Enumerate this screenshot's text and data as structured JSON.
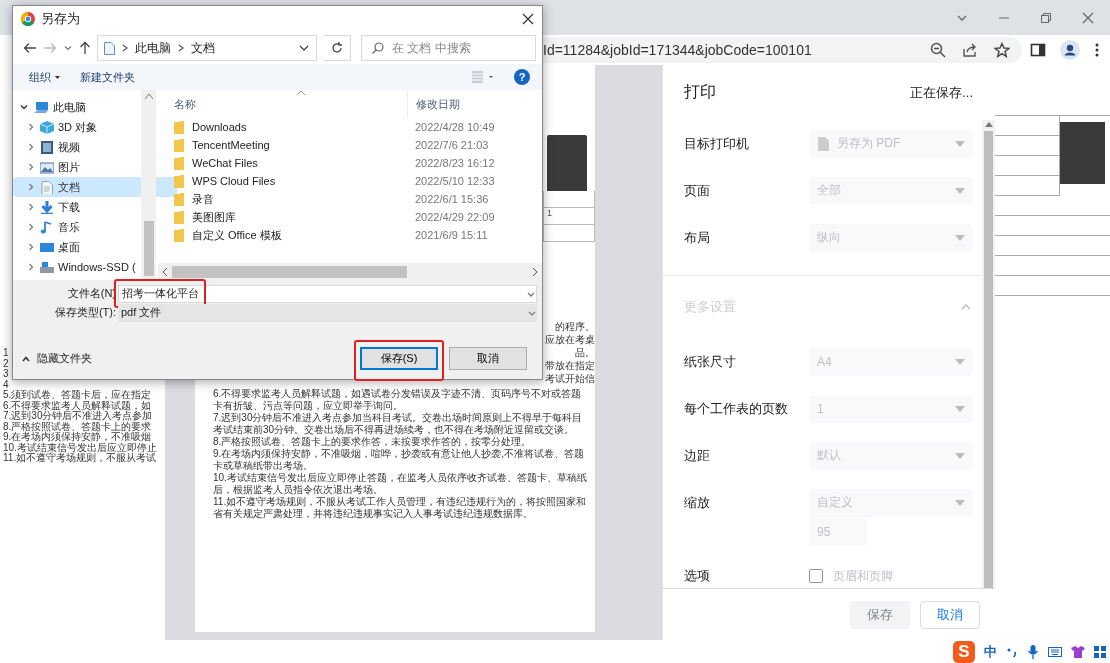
{
  "browser": {
    "url": "Id=11284&jobId=171344&jobCode=100101"
  },
  "left_page": {
    "numbers": [
      "1",
      "2",
      "3",
      "4"
    ],
    "lines": [
      "5.须到试卷、答题卡后，应在指定",
      "6.不得要求监考人员解释试题，如",
      "7.迟到30分钟后不准进入考点参加",
      "8.严格按照试卷、答题卡上的要求",
      "9.在考场内须保持安静，不准吸烟",
      "10.考试结束信号发出后应立即停止",
      "11.如不遵守考场规则，不服从考试"
    ]
  },
  "preview_page": {
    "cell": "1",
    "fragments": [
      "的程序。",
      "应放在考桌",
      "品。",
      "带放在指定",
      "考试开始信"
    ],
    "rules": [
      "6.不得要求监考人员解释试题，如遇试卷分发错误及字迹不清、页码序号不对或答题卡有折皱、污点等问题，应立即举手询问。",
      "7.迟到30分钟后不准进入考点参加当科目考试。交卷出场时间原则上不得早于每科目考试结束前30分钟。交卷出场后不得再进场续考，也不得在考场附近逗留或交谈。",
      "8.严格按照试卷、答题卡上的要求作答，未按要求作答的，按零分处理。",
      "9.在考场内须保持安静，不准吸烟，喧哗，抄袭或有意让他人抄袭,不准将试卷、答题卡或草稿纸带出考场。",
      "10.考试结束信号发出后应立即停止答题，在监考人员依序收齐试卷、答题卡、草稿纸后，根据监考人员指令依次退出考场。",
      "11.如不遵守考场规则，不服从考试工作人员管理，有违纪违规行为的，将按照国家和省有关规定严肃处理，并将违纪违规事实记入人事考试违纪违规数据库。"
    ]
  },
  "print_panel": {
    "title": "打印",
    "status": "正在保存...",
    "settings": [
      {
        "label": "目标打印机",
        "value": "另存为 PDF",
        "kind": "printer",
        "disabled": true
      },
      {
        "label": "页面",
        "value": "全部",
        "kind": "select",
        "disabled": true
      },
      {
        "label": "布局",
        "value": "纵向",
        "kind": "select",
        "disabled": true
      }
    ],
    "more_settings": {
      "label": "更多设置",
      "expanded": true
    },
    "more": [
      {
        "label": "纸张尺寸",
        "value": "A4",
        "kind": "select",
        "disabled": true
      },
      {
        "label": "每个工作表的页数",
        "value": "1",
        "kind": "select",
        "disabled": true
      },
      {
        "label": "边距",
        "value": "默认",
        "kind": "select",
        "disabled": true
      },
      {
        "label": "缩放",
        "value": "自定义",
        "kind": "select",
        "disabled": true,
        "input": "95"
      },
      {
        "label": "选项",
        "value": "页眉和页脚",
        "kind": "checkbox",
        "disabled": true,
        "checked": false
      }
    ],
    "buttons": [
      {
        "label": "保存",
        "kind": "primary",
        "disabled": true
      },
      {
        "label": "取消",
        "kind": "secondary",
        "disabled": false
      }
    ]
  },
  "save_dialog": {
    "title": "另存为",
    "path": [
      "此电脑",
      "文档"
    ],
    "search_placeholder": "在 文档 中搜索",
    "organize": "组织",
    "new_folder": "新建文件夹",
    "help": "?",
    "tree": [
      {
        "label": "此电脑",
        "kind": "pc",
        "expanded": true,
        "selected": false,
        "children": [
          {
            "label": "3D 对象",
            "kind": "cube",
            "expanded": false,
            "selected": false
          },
          {
            "label": "视频",
            "kind": "video",
            "expanded": false,
            "selected": false
          },
          {
            "label": "图片",
            "kind": "picture",
            "expanded": false,
            "selected": false
          },
          {
            "label": "文档",
            "kind": "document",
            "expanded": false,
            "selected": true
          },
          {
            "label": "下载",
            "kind": "download",
            "expanded": false,
            "selected": false
          },
          {
            "label": "音乐",
            "kind": "music",
            "expanded": false,
            "selected": false
          },
          {
            "label": "桌面",
            "kind": "desktop",
            "expanded": false,
            "selected": false
          },
          {
            "label": "Windows-SSD (",
            "kind": "drive",
            "expanded": false,
            "selected": false
          }
        ]
      }
    ],
    "columns": [
      "名称",
      "修改日期"
    ],
    "files": [
      {
        "name": "Downloads",
        "date": "2022/4/28 10:49"
      },
      {
        "name": "TencentMeeting",
        "date": "2022/7/6 21:03"
      },
      {
        "name": "WeChat Files",
        "date": "2022/8/23 16:12"
      },
      {
        "name": "WPS Cloud Files",
        "date": "2022/5/10 12:33"
      },
      {
        "name": "录音",
        "date": "2022/6/1 15:36"
      },
      {
        "name": "美图图库",
        "date": "2022/4/29 22:09"
      },
      {
        "name": "自定义 Office 模板",
        "date": "2021/6/9 15:11"
      }
    ],
    "file_name": {
      "label": "文件名(N)",
      "value": "招考一体化平台",
      "highlighted": true
    },
    "file_type": {
      "label": "保存类型(T):",
      "value": "pdf 文件"
    },
    "hide_folders": "隐藏文件夹",
    "buttons": [
      {
        "label": "保存(S)",
        "kind": "primary",
        "highlighted": true
      },
      {
        "label": "取消",
        "kind": "secondary",
        "highlighted": false
      }
    ]
  },
  "ime": {
    "logo": "S",
    "mode": "中"
  }
}
